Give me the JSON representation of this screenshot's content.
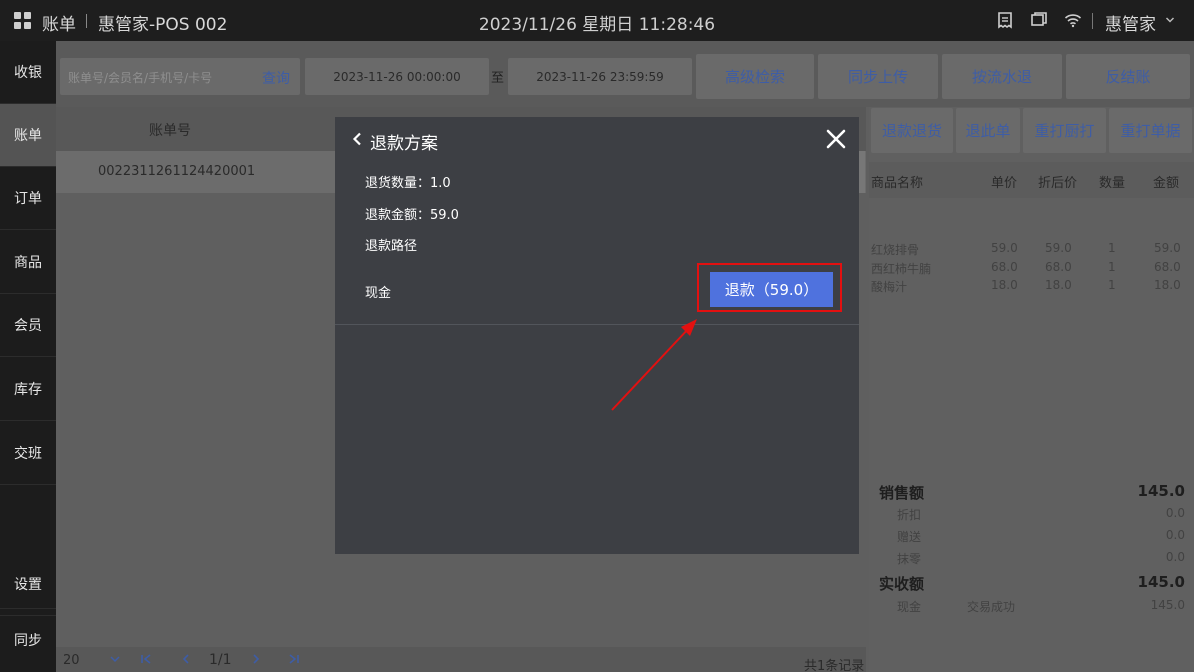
{
  "topbar": {
    "title": "账单",
    "device": "惠管家-POS 002",
    "datetime": "2023/11/26 星期日 11:28:46",
    "user": "惠管家",
    "icons": [
      "grid-icon",
      "receipt-icon",
      "window-icon",
      "wifi-icon",
      "chevron-down-icon"
    ]
  },
  "sidebar": {
    "items": [
      {
        "label": "收银"
      },
      {
        "label": "账单"
      },
      {
        "label": "订单"
      },
      {
        "label": "商品"
      },
      {
        "label": "会员"
      },
      {
        "label": "库存"
      },
      {
        "label": "交班"
      }
    ],
    "bottom_items": [
      {
        "label": "设置"
      },
      {
        "label": "同步"
      }
    ],
    "active": "账单"
  },
  "filters": {
    "search_placeholder": "账单号/会员名/手机号/卡号",
    "query_label": "查询",
    "start_date": "2023-11-26 00:00:00",
    "to_label": "至",
    "end_date": "2023-11-26 23:59:59",
    "buttons": [
      "高级检索",
      "同步上传",
      "按流水退",
      "反结账"
    ]
  },
  "bill_list": {
    "header": "账单号",
    "rows": [
      "0022311261124420001"
    ]
  },
  "pager": {
    "page_size": "20",
    "page": "1/1",
    "total": "共1条记录"
  },
  "detail": {
    "buttons": [
      "退款退货",
      "退此单",
      "重打厨打",
      "重打单据"
    ],
    "columns": [
      "商品名称",
      "单价",
      "折后价",
      "数量",
      "金额"
    ],
    "items": [
      {
        "name": "红烧排骨",
        "price": "59.0",
        "discounted": "59.0",
        "qty": "1",
        "amount": "59.0"
      },
      {
        "name": "西红柿牛腩",
        "price": "68.0",
        "discounted": "68.0",
        "qty": "1",
        "amount": "68.0"
      },
      {
        "name": "酸梅汁",
        "price": "18.0",
        "discounted": "18.0",
        "qty": "1",
        "amount": "18.0"
      }
    ],
    "summary": {
      "sales_label": "销售额",
      "sales_value": "145.0",
      "discount_label": "折扣",
      "discount_value": "0.0",
      "gift_label": "赠送",
      "gift_value": "0.0",
      "rounding_label": "抹零",
      "rounding_value": "0.0",
      "received_label": "实收额",
      "received_value": "145.0",
      "pay_method": "现金",
      "pay_status": "交易成功",
      "pay_value": "145.0"
    }
  },
  "modal": {
    "title": "退款方案",
    "return_qty_label": "退货数量：1.0",
    "refund_amount_label": "退款金额：59.0",
    "refund_path_label": "退款路径",
    "method_label": "现金",
    "refund_button": "退款（59.0）"
  },
  "colors": {
    "accent": "#4f72de",
    "highlight": "#e31010"
  }
}
